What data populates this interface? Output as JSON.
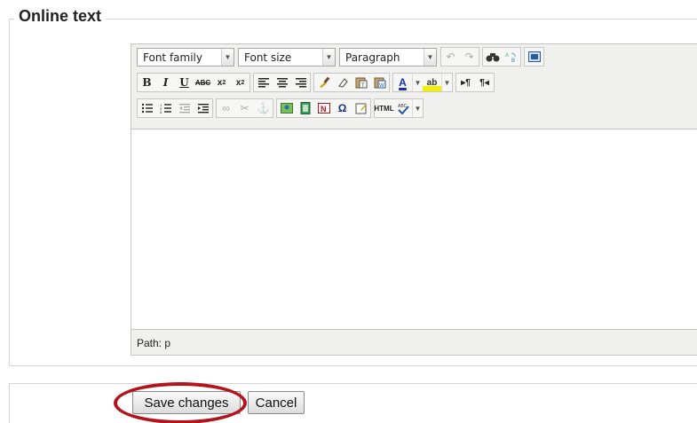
{
  "section": {
    "legend": "Online text"
  },
  "editor": {
    "font_family": "Font family",
    "font_size": "Font size",
    "format": "Paragraph",
    "row1_icons": [
      "undo-icon",
      "redo-icon",
      "find-icon",
      "replace-icon",
      "fullscreen-icon"
    ],
    "row2_icons": [
      "bold-icon",
      "italic-icon",
      "underline-icon",
      "strikethrough-icon",
      "subscript-icon",
      "superscript-icon",
      "align-left-icon",
      "align-center-icon",
      "align-right-icon",
      "cleanup-icon",
      "remove-format-icon",
      "paste-text-icon",
      "paste-word-icon",
      "text-color-icon",
      "highlight-color-icon",
      "ltr-icon",
      "rtl-icon"
    ],
    "row3_icons": [
      "bullet-list-icon",
      "numbered-list-icon",
      "outdent-icon",
      "indent-icon",
      "link-icon",
      "unlink-icon",
      "anchor-icon",
      "image-icon",
      "media-icon",
      "nonbreaking-icon",
      "special-char-icon",
      "edit-icon",
      "html-icon",
      "spellcheck-icon"
    ],
    "status_path": "Path: p"
  },
  "buttons": {
    "save": "Save changes",
    "cancel": "Cancel"
  },
  "colors": {
    "highlight": "#b3141b",
    "text_color": "#1b2cb8",
    "highlight_bg": "#f2f200"
  }
}
